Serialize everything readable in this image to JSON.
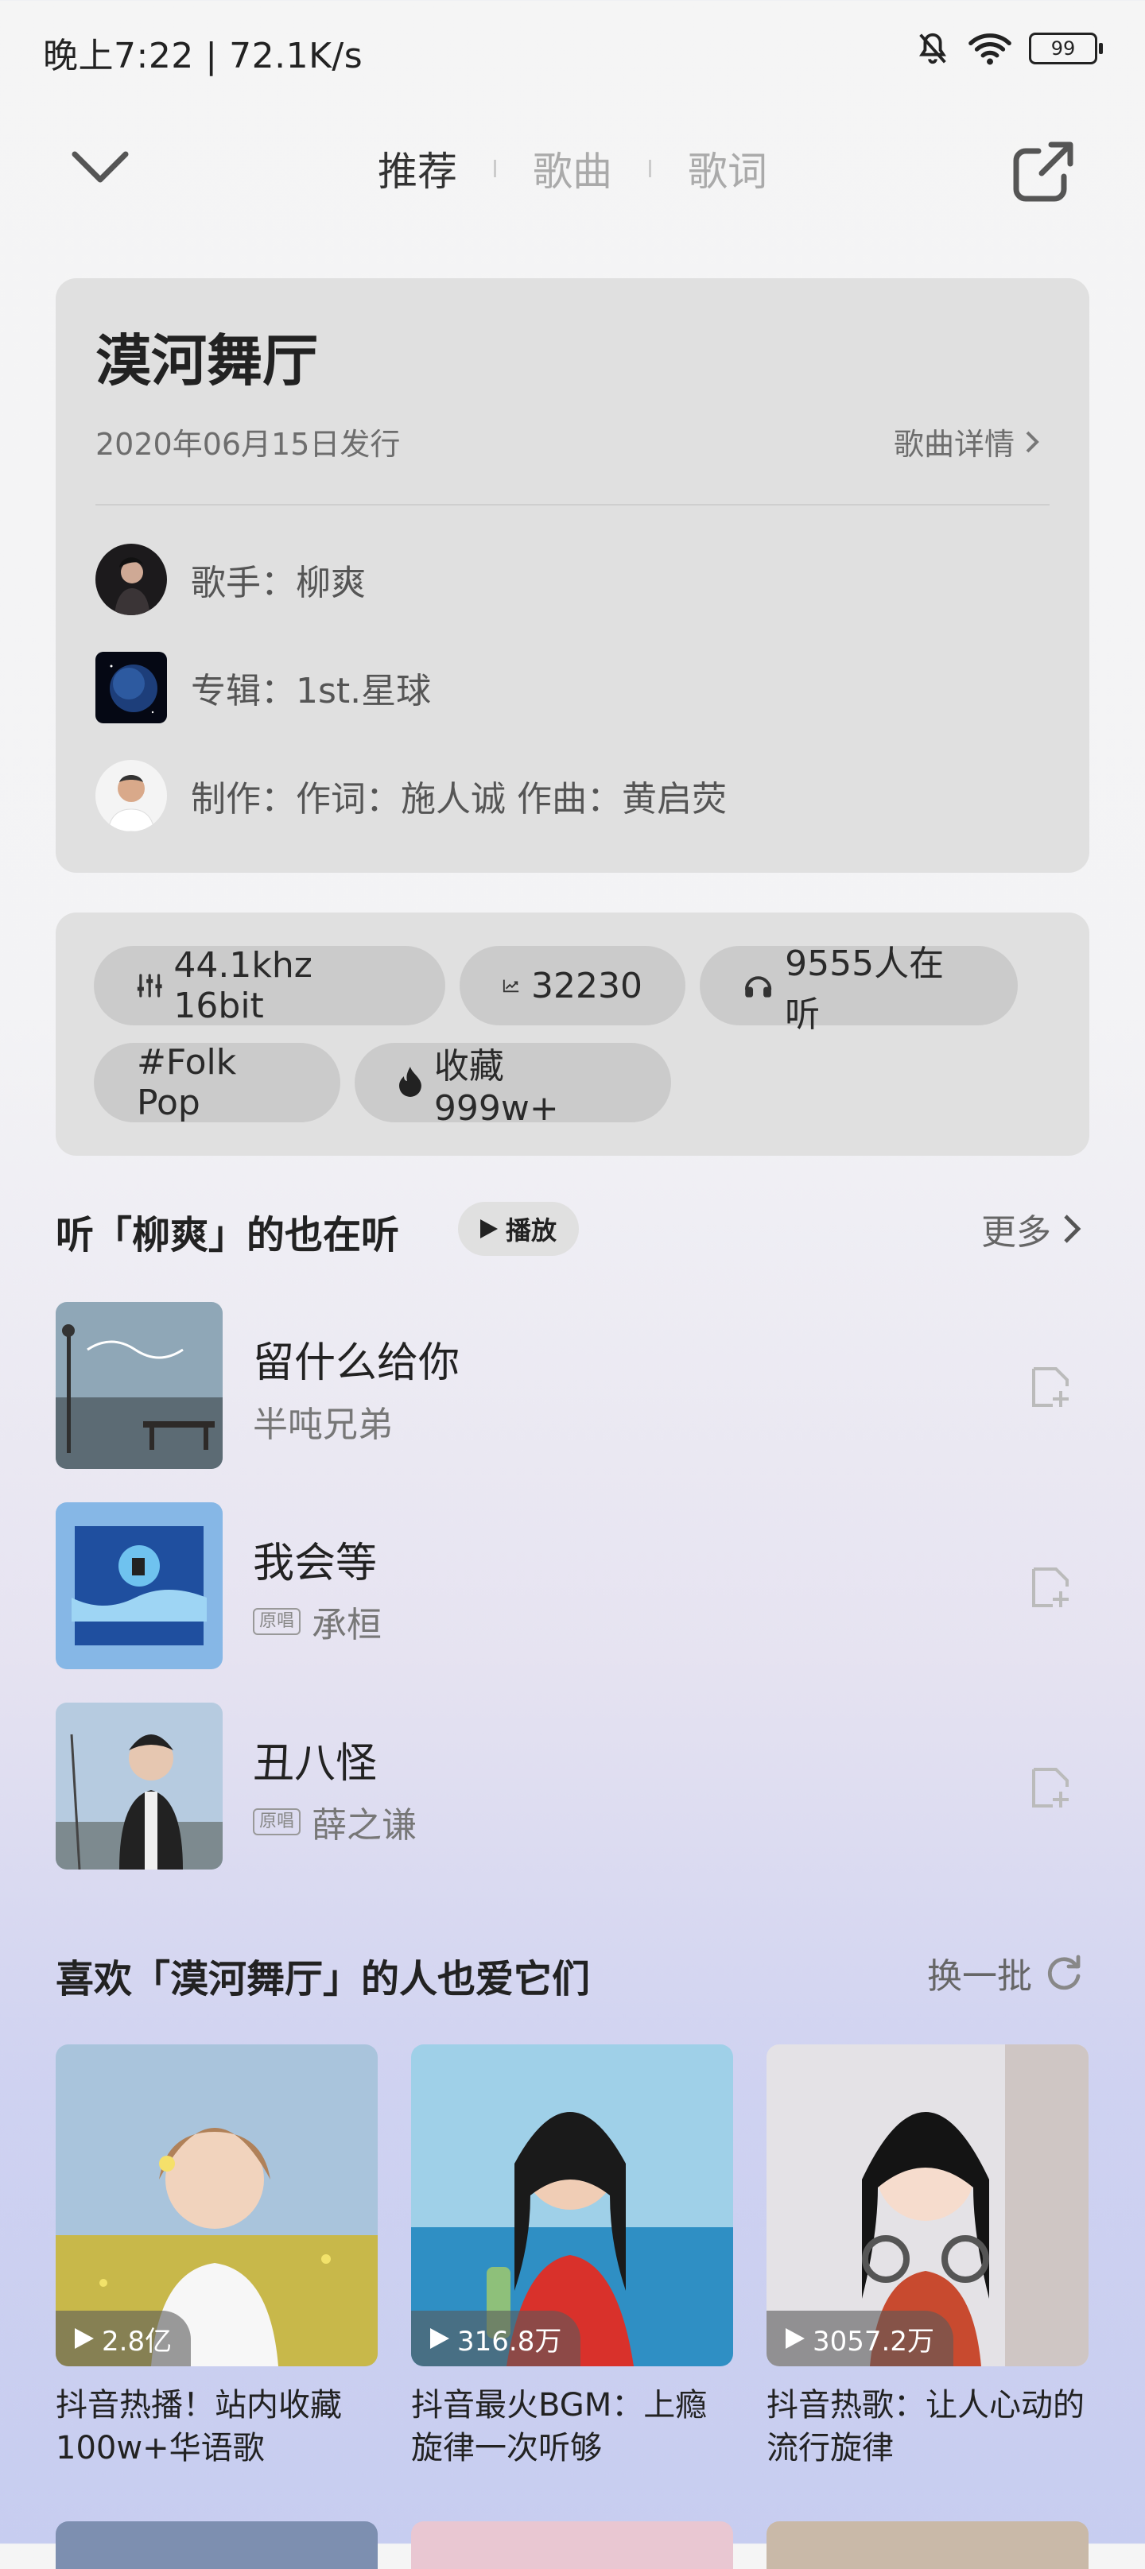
{
  "status_bar": {
    "time_speed": "晚上7:22 | 72.1K/s",
    "battery": "99",
    "icons": [
      "mute-icon",
      "wifi-icon",
      "battery-icon"
    ]
  },
  "nav": {
    "tabs": [
      "推荐",
      "歌曲",
      "歌词"
    ],
    "active": "推荐",
    "icons": [
      "chevron-down-icon",
      "share-icon"
    ]
  },
  "song": {
    "title": "漠河舞厅",
    "release": "2020年06月15日发行",
    "detail_link": "歌曲详情",
    "singer": "歌手：柳爽",
    "album": "专辑：1st.星球",
    "credits": "制作：作词：施人诚  作曲：黄启荧"
  },
  "tags": {
    "quality": "44.1khz  16bit",
    "trend": "32230",
    "listening": "9555人在听",
    "genre": "#Folk Pop",
    "favorites": "收藏999w+"
  },
  "similar": {
    "title": "听「柳爽」的也在听",
    "play_label": "播放",
    "more_label": "更多",
    "songs": [
      {
        "name": "留什么给你",
        "artist": "半吨兄弟",
        "tag": ""
      },
      {
        "name": "我会等",
        "artist": "承桓",
        "tag": "原唱"
      },
      {
        "name": "丑八怪",
        "artist": "薛之谦",
        "tag": "原唱"
      }
    ]
  },
  "recommend": {
    "title": "喜欢「漠河舞厅」的人也爱它们",
    "refresh_label": "换一批",
    "playlists": [
      {
        "count": "2.8亿",
        "title": "抖音热播！站内收藏100w+华语歌"
      },
      {
        "count": "316.8万",
        "title": "抖音最火BGM：上瘾旋律一次听够"
      },
      {
        "count": "3057.2万",
        "title": "抖音热歌：让人心动的流行旋律"
      }
    ]
  },
  "colors": {
    "card_bg": "#e0e0e0",
    "pill_bg": "#cbcbcb",
    "accent_text": "#222222"
  }
}
